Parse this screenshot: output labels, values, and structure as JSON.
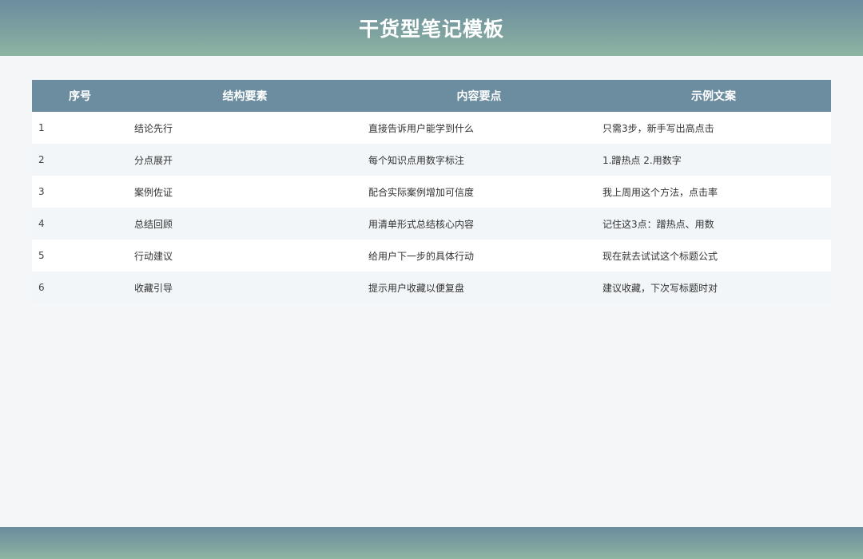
{
  "header": {
    "title": "干货型笔记模板"
  },
  "table": {
    "columns": [
      "序号",
      "结构要素",
      "内容要点",
      "示例文案"
    ],
    "rows": [
      {
        "no": "1",
        "element": "结论先行",
        "point": "直接告诉用户能学到什么",
        "example": "只需3步，新手写出高点击"
      },
      {
        "no": "2",
        "element": "分点展开",
        "point": "每个知识点用数字标注",
        "example": "1.蹭热点 2.用数字"
      },
      {
        "no": "3",
        "element": "案例佐证",
        "point": "配合实际案例增加可信度",
        "example": "我上周用这个方法，点击率"
      },
      {
        "no": "4",
        "element": "总结回顾",
        "point": "用清单形式总结核心内容",
        "example": "记住这3点：蹭热点、用数"
      },
      {
        "no": "5",
        "element": "行动建议",
        "point": "给用户下一步的具体行动",
        "example": "现在就去试试这个标题公式"
      },
      {
        "no": "6",
        "element": "收藏引导",
        "point": "提示用户收藏以便复盘",
        "example": "建议收藏，下次写标题时对"
      }
    ]
  },
  "colors": {
    "header_gradient_top": "#6b8d9f",
    "header_gradient_bottom": "#8eb5a3",
    "table_header_bg": "#6b8d9f",
    "page_bg": "#f4f6f8",
    "row_alt_bg": "#f3f6f8"
  }
}
